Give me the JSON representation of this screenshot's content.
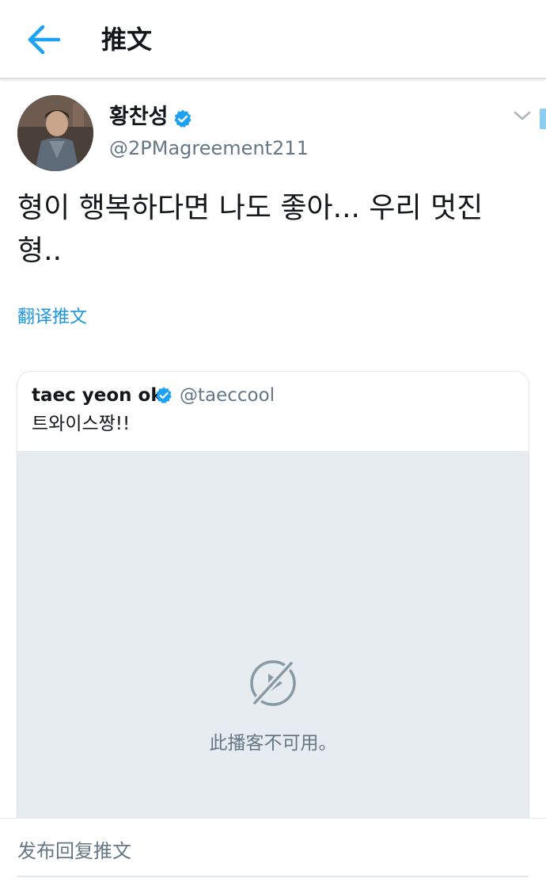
{
  "header": {
    "title": "推文",
    "back_icon": "arrow-left-icon",
    "accent_color": "#1da1f2"
  },
  "tweet": {
    "author_name": "황찬성",
    "author_handle": "@2PMagreement211",
    "verified": true,
    "text": "형이 행복하다면 나도 좋아... 우리 멋진 형..",
    "translate_label": "翻译推文",
    "menu_icon": "chevron-down-icon"
  },
  "quoted_tweet": {
    "author_name": "taec yeon ok",
    "author_handle": "@taeccool",
    "verified": true,
    "text": "트와이스짱!!",
    "media": {
      "status_icon": "media-unavailable-icon",
      "status_text": "此播客不可用。"
    }
  },
  "reply": {
    "placeholder": "发布回复推文"
  }
}
